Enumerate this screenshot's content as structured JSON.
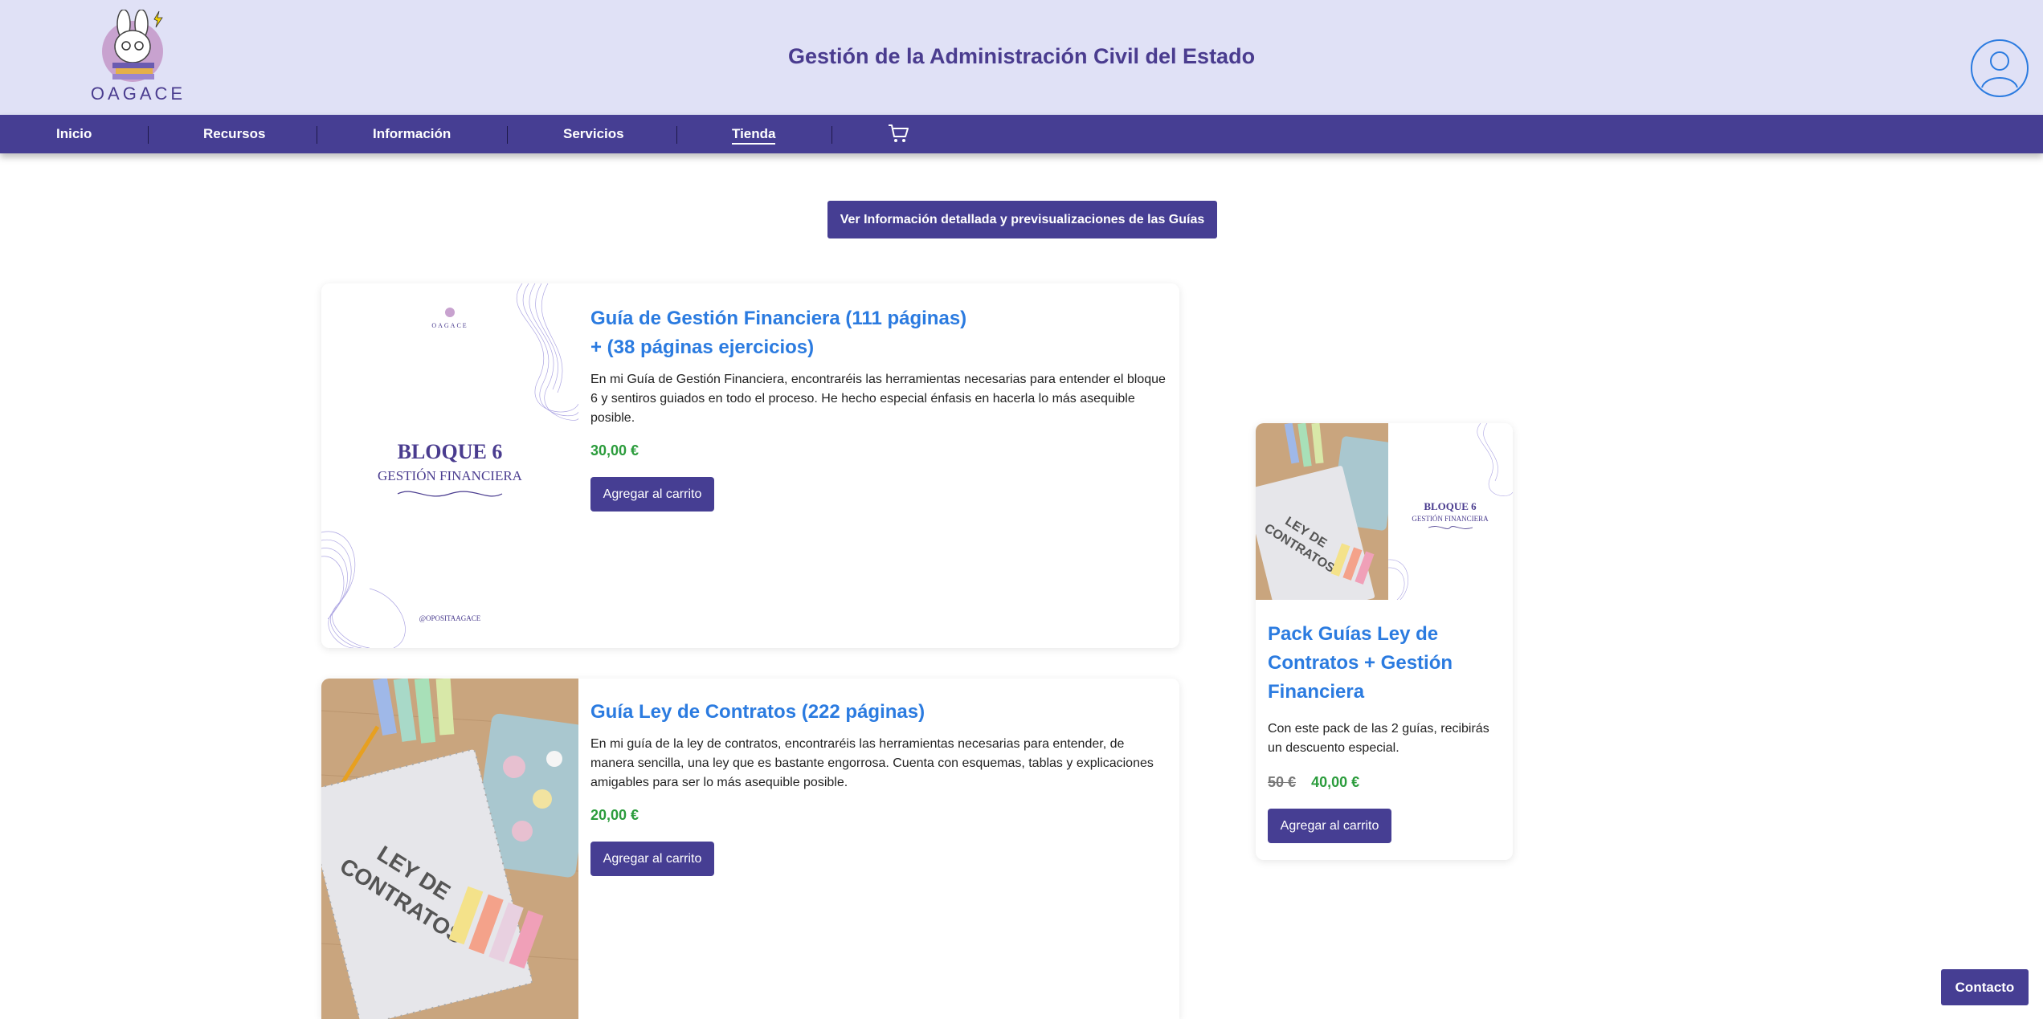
{
  "header": {
    "logo_text": "OAGACE",
    "title": "Gestión de la Administración Civil del Estado"
  },
  "nav": {
    "items": [
      {
        "label": "Inicio"
      },
      {
        "label": "Recursos"
      },
      {
        "label": "Información"
      },
      {
        "label": "Servicios"
      },
      {
        "label": "Tienda",
        "active": true
      }
    ],
    "cart_icon": "cart-icon"
  },
  "main": {
    "detail_button": "Ver Información detallada y previsualizaciones de las Guías"
  },
  "products": [
    {
      "title_line1": "Guía de Gestión Financiera (111 páginas)",
      "title_line2": "+ (38 páginas ejercicios)",
      "description": "En mi Guía de Gestión Financiera, encontraréis las herramientas necesarias para entender el bloque 6 y sentiros guiados en todo el proceso. He hecho especial énfasis en hacerla lo más asequible posible.",
      "price": "30,00 €",
      "button": "Agregar al carrito",
      "cover": {
        "logo": "OAGACE",
        "bloque": "BLOQUE 6",
        "subject": "GESTIÓN FINANCIERA",
        "handle": "@OPOSITAAGACE"
      }
    },
    {
      "title": "Guía Ley de Contratos (222 páginas)",
      "description": "En mi guía de la ley de contratos, encontraréis las herramientas necesarias para entender, de manera sencilla, una ley que es bastante engorrosa. Cuenta con esquemas, tablas y explicaciones amigables para ser lo más asequible posible.",
      "price": "20,00 €",
      "button": "Agregar al carrito",
      "cover": {
        "book_title_1": "LEY DE",
        "book_title_2": "CONTRATOS"
      }
    },
    {
      "title_line1": "Pack Guías Ley de",
      "title_line2": "Contratos + Gestión",
      "title_line3": "Financiera",
      "description": "Con este pack de las 2 guías, recibirás un descuento especial.",
      "old_price": "50 €",
      "price": "40,00 €",
      "button": "Agregar al carrito",
      "cover": {
        "book_title_1": "LEY DE",
        "book_title_2": "CONTRATOS",
        "bloque": "BLOQUE 6",
        "subject": "GESTIÓN FINANCIERA"
      }
    }
  ],
  "contact_button": "Contacto",
  "colors": {
    "header_bg": "#e0e1f6",
    "brand": "#463e93",
    "link": "#2b7be0",
    "price": "#2b9c3c"
  }
}
